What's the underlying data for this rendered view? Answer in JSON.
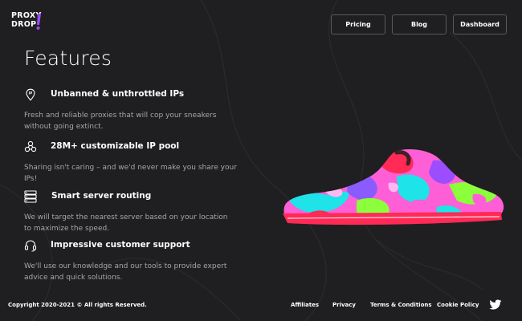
{
  "logo": {
    "line1": "PROXY",
    "line2": "DROP"
  },
  "nav": {
    "pricing": "Pricing",
    "blog": "Blog",
    "dashboard": "Dashboard"
  },
  "page_title": "Features",
  "features": [
    {
      "icon": "location-pin-icon",
      "heading": "Unbanned & unthrottled IPs",
      "description": "Fresh and reliable proxies that will cop your sneakers without going extinct."
    },
    {
      "icon": "network-nodes-icon",
      "heading": "28M+ customizable IP pool",
      "description": "Sharing isn't caring – and we'd never make you share your IPs!"
    },
    {
      "icon": "server-icon",
      "heading": "Smart server routing",
      "description": "We will target the nearest server based on your location to maximize the speed."
    },
    {
      "icon": "headset-icon",
      "heading": "Impressive customer support",
      "description": "We'll use our knowledge and our tools to provide expert advice and quick solutions."
    }
  ],
  "footer": {
    "copyright": "Copyright 2020-2021 © All rights Reserved.",
    "links": {
      "affiliates": "Affiliates",
      "privacy": "Privacy",
      "terms": "Terms & Conditions",
      "cookie": "Cookie Policy"
    },
    "social_icon": "twitter-icon"
  },
  "colors": {
    "background": "#1f1f21",
    "text_muted": "#a6a6a8",
    "accent_purple": "#9b4dff",
    "shoe_pink": "#ff5fd6",
    "shoe_cyan": "#1ee3e8",
    "shoe_green": "#8cff3c",
    "shoe_red": "#ff2a55"
  }
}
